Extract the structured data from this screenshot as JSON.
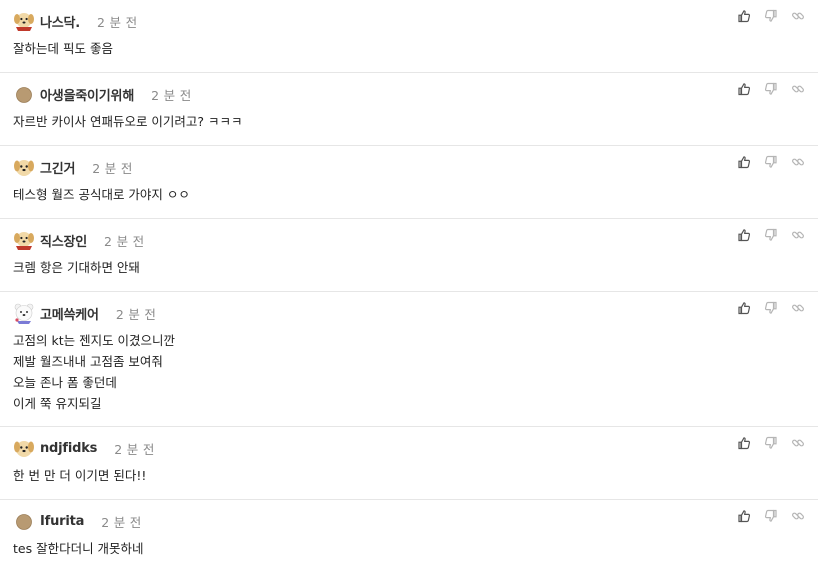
{
  "comments": [
    {
      "avatar": "puppy-scarf-avatar",
      "nick": "나스닥.",
      "time": "2 분 전",
      "lines": [
        "잘하는데 픽도 좋음"
      ]
    },
    {
      "avatar": "default-circle-avatar",
      "nick": "아생을죽이기위해",
      "time": "2 분 전",
      "lines": [
        "자르반 카이사 연패듀오로 이기려고? ㅋㅋㅋ"
      ]
    },
    {
      "avatar": "puppy-avatar",
      "nick": "그긴거",
      "time": "2 분 전",
      "lines": [
        "테스형 월즈 공식대로 가야지 ㅇㅇ"
      ]
    },
    {
      "avatar": "puppy-scarf-avatar",
      "nick": "직스장인",
      "time": "2 분 전",
      "lines": [
        "크렘 항은 기대하면 안돼"
      ]
    },
    {
      "avatar": "bear-avatar",
      "nick": "고메쓱케어",
      "time": "2 분 전",
      "lines": [
        "고점의 kt는 젠지도 이겼으니깐",
        "제발 월즈내내 고점좀 보여줘",
        "오늘 존나 폼 좋던데",
        "이게 쭉 유지되길"
      ]
    },
    {
      "avatar": "puppy-avatar",
      "nick": "ndjfidks",
      "time": "2 분 전",
      "lines": [
        "한 번 만 더 이기면 된다!!"
      ]
    },
    {
      "avatar": "default-circle-avatar",
      "nick": "Ifurita",
      "time": "2 분 전",
      "lines": [
        "tes 잘한다더니 개못하네"
      ]
    }
  ],
  "icons": {
    "like": "thumbs-up-icon",
    "dislike": "thumbs-down-icon",
    "share": "link-icon"
  },
  "colors": {
    "icon_active": "#555555",
    "icon_muted": "#b5b5b5",
    "divider": "#e6e6e6"
  }
}
